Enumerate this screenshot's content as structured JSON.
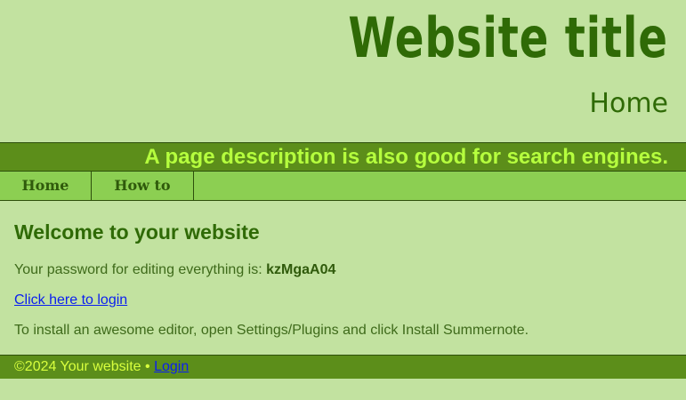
{
  "header": {
    "site_title": "Website title",
    "page_name": "Home",
    "description": "A page description is also good for search engines."
  },
  "nav": {
    "items": [
      {
        "label": "Home"
      },
      {
        "label": "How to"
      }
    ]
  },
  "main": {
    "heading": "Welcome to your website",
    "password_text": "Your password for editing everything is: ",
    "password_value": "kzMgaA04",
    "login_link": "Click here to login",
    "install_text": "To install an awesome editor, open Settings/Plugins and click Install Summernote."
  },
  "footer": {
    "copyright": "©2024 Your website • ",
    "login_link": "Login"
  },
  "colors": {
    "background": "#c2e2a0",
    "title_green": "#2f6a06",
    "bar_green": "#5c8e1a",
    "nav_green": "#8ccf52",
    "description_text": "#b6ff3e",
    "link_blue": "#0a1ef0"
  }
}
